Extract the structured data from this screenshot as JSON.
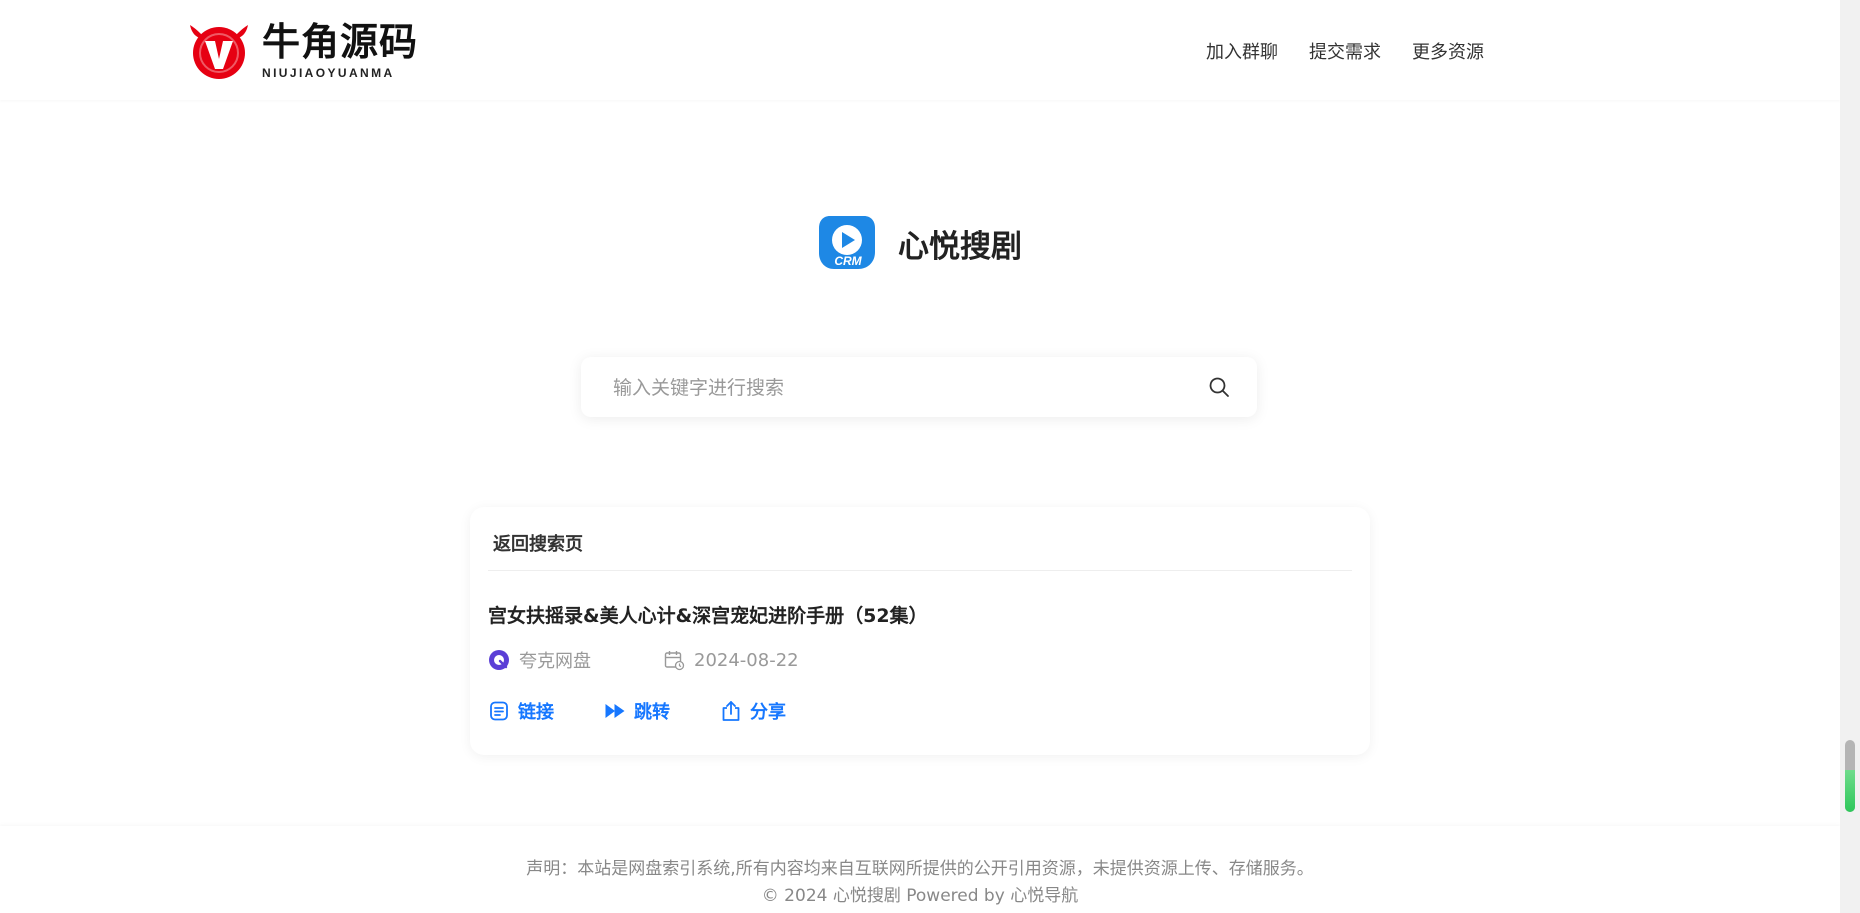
{
  "header": {
    "logo": {
      "name_cn": "牛角源码",
      "name_en": "NIUJIAOYUANMA"
    },
    "nav": [
      {
        "label": "加入群聊"
      },
      {
        "label": "提交需求"
      },
      {
        "label": "更多资源"
      }
    ]
  },
  "brand": {
    "icon": "crm-play-logo",
    "icon_text": "CRM",
    "name": "心悦搜剧"
  },
  "search": {
    "placeholder": "输入关键字进行搜索",
    "value": "",
    "icon": "search-icon"
  },
  "result_card": {
    "back_label": "返回搜索页",
    "title": "宫女扶摇录&美人心计&深宫宠妃进阶手册（52集）",
    "source": {
      "icon": "quark-drive-icon",
      "label": "夸克网盘"
    },
    "date": {
      "icon": "calendar-icon",
      "label": "2024-08-22"
    },
    "actions": [
      {
        "icon": "link-doc-icon",
        "label": "链接"
      },
      {
        "icon": "fast-forward-icon",
        "label": "跳转"
      },
      {
        "icon": "share-icon",
        "label": "分享"
      }
    ]
  },
  "footer": {
    "disclaimer": "声明：本站是网盘索引系统,所有内容均来自互联网所提供的公开引用资源，未提供资源上传、存储服务。",
    "copyright": "© 2024 心悦搜剧 Powered by 心悦导航"
  },
  "colors": {
    "accent": "#1677ff",
    "logo_red": "#e60012",
    "brand_blue": "#1e88e5",
    "quark_purple": "#5b3fd6",
    "text_muted": "#999999"
  }
}
